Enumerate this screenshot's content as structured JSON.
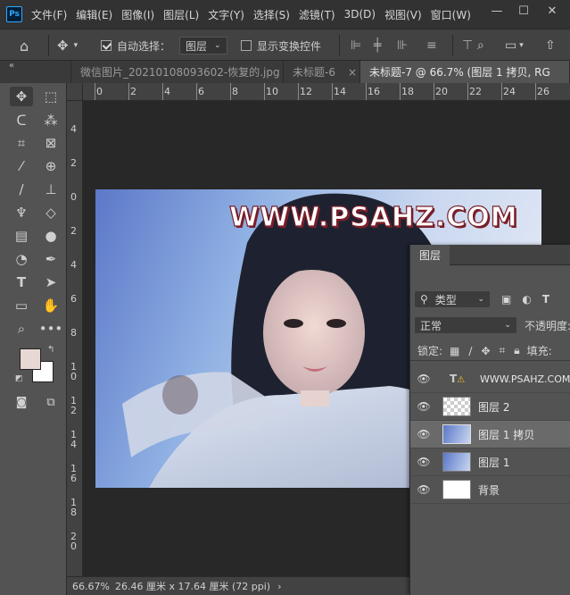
{
  "app": {
    "logo": "Ps"
  },
  "menu": [
    "文件(F)",
    "编辑(E)",
    "图像(I)",
    "图层(L)",
    "文字(Y)",
    "选择(S)",
    "滤镜(T)",
    "3D(D)",
    "视图(V)",
    "窗口(W)"
  ],
  "window_controls": {
    "minimize": "—",
    "restore": "☐",
    "close": "✕"
  },
  "options": {
    "auto_select_label": "自动选择：",
    "auto_select_value": "图层",
    "show_transform_label": "显示变换控件"
  },
  "tabs": [
    {
      "label": "微信图片_20210108093602-恢复的.jpg",
      "close": "×"
    },
    {
      "label": "未标题-6",
      "close": "×"
    },
    {
      "label": "未标题-7 @ 66.7% (图层 1 拷贝, RG",
      "close": ""
    }
  ],
  "panel_collapse": "«",
  "ruler_h": [
    "0",
    "2",
    "4",
    "6",
    "8",
    "10",
    "12",
    "14",
    "16",
    "18",
    "20",
    "22",
    "24",
    "26"
  ],
  "ruler_v": [
    "4",
    "2",
    "0",
    "2",
    "4",
    "6",
    "8",
    "1 0",
    "1 2",
    "1 4",
    "1 6",
    "1 8",
    "2 0"
  ],
  "watermark": "WWW.PSAHZ.COM",
  "status": {
    "zoom": "66.67%",
    "doc": "26.46 厘米 x 17.64 厘米 (72 ppi)",
    "arrow": "›"
  },
  "layers_panel": {
    "title": "图层",
    "filter_kind": "类型",
    "blend_mode": "正常",
    "opacity_label": "不透明度:",
    "lock_label": "锁定:",
    "fill_label": "填充:",
    "layers": [
      {
        "name": "WWW.PSAHZ.COM",
        "type": "text",
        "visible": true,
        "active": false
      },
      {
        "name": "图层 2",
        "type": "transparent",
        "visible": true,
        "active": false
      },
      {
        "name": "图层 1 拷贝",
        "type": "photo",
        "visible": true,
        "active": true
      },
      {
        "name": "图层 1",
        "type": "photo",
        "visible": true,
        "active": false
      },
      {
        "name": "背景",
        "type": "white",
        "visible": true,
        "active": false
      }
    ]
  },
  "colors": {
    "foreground": "#e8d8d5",
    "background": "#ffffff",
    "accent": "#31a8ff"
  }
}
